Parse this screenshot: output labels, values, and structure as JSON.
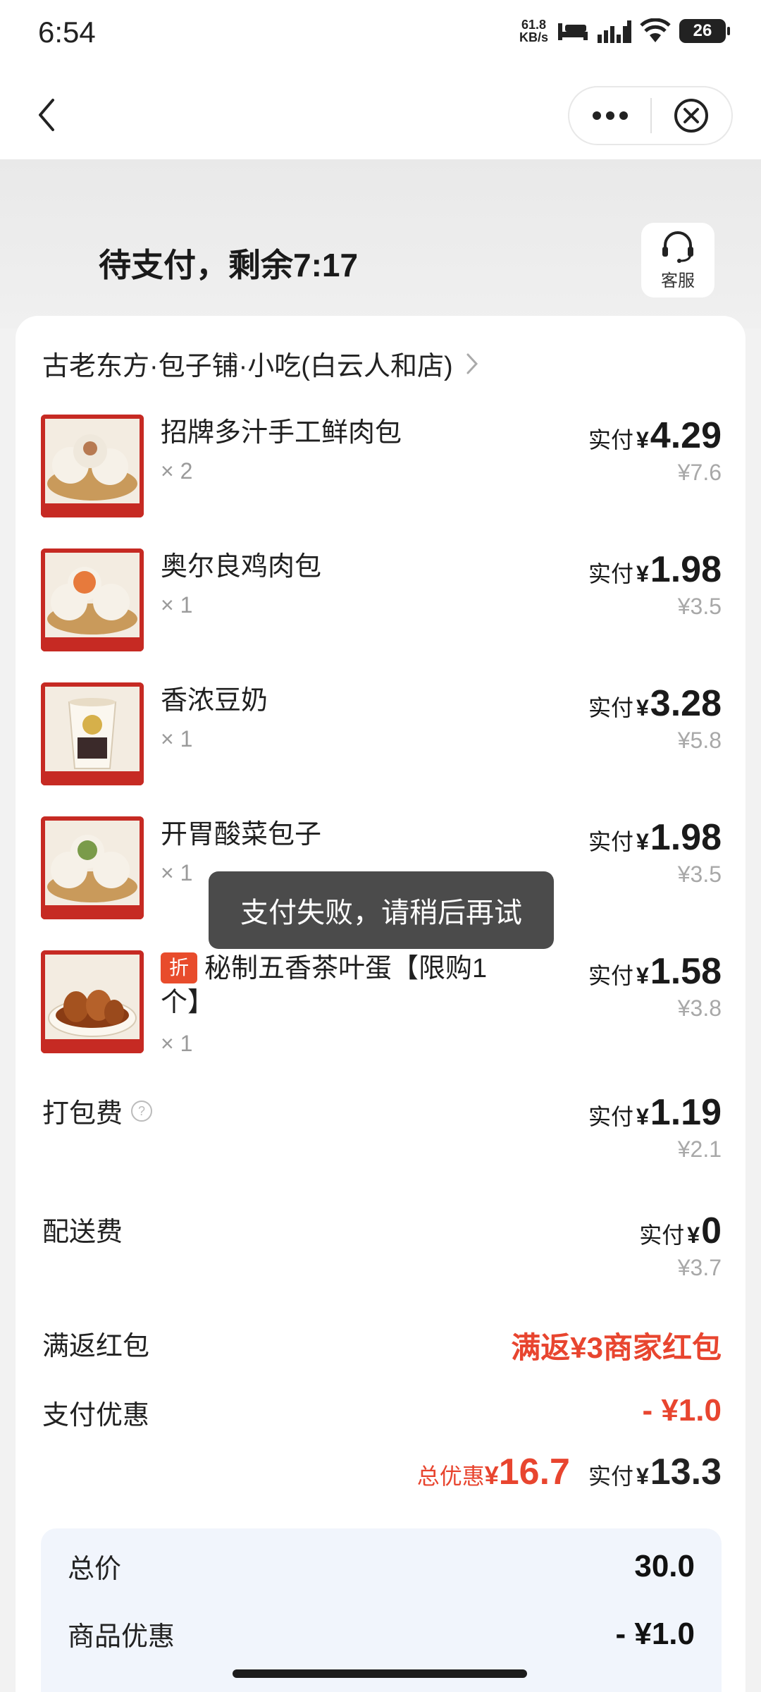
{
  "status_bar": {
    "time": "6:54",
    "net_speed_value": "61.8",
    "net_speed_unit": "KB/s",
    "battery": "26"
  },
  "nav": {
    "back_icon": "chevron-left-icon",
    "more_icon": "more-dots-icon",
    "close_icon": "close-circle-icon"
  },
  "header": {
    "status_text": "待支付，剩余7:17",
    "service_label": "客服"
  },
  "store": {
    "name": "古老东方·包子铺·小吃(白云人和店)"
  },
  "items": [
    {
      "name": "招牌多汁手工鲜肉包",
      "qty": "× 2",
      "paid_label": "实付",
      "yen": "¥",
      "paid": "4.29",
      "original": "¥7.6",
      "tag": ""
    },
    {
      "name": "奥尔良鸡肉包",
      "qty": "× 1",
      "paid_label": "实付",
      "yen": "¥",
      "paid": "1.98",
      "original": "¥3.5",
      "tag": ""
    },
    {
      "name": "香浓豆奶",
      "qty": "× 1",
      "paid_label": "实付",
      "yen": "¥",
      "paid": "3.28",
      "original": "¥5.8",
      "tag": ""
    },
    {
      "name": "开胃酸菜包子",
      "qty": "× 1",
      "paid_label": "实付",
      "yen": "¥",
      "paid": "1.98",
      "original": "¥3.5",
      "tag": ""
    },
    {
      "name": "秘制五香茶叶蛋【限购1个】",
      "qty": "× 1",
      "paid_label": "实付",
      "yen": "¥",
      "paid": "1.58",
      "original": "¥3.8",
      "tag": "折"
    }
  ],
  "fees": {
    "packing": {
      "label": "打包费",
      "paid_label": "实付",
      "yen": "¥",
      "paid": "1.19",
      "original": "¥2.1"
    },
    "delivery": {
      "label": "配送费",
      "paid_label": "实付",
      "yen": "¥",
      "paid": "0",
      "original": "¥3.7"
    },
    "red_packet": {
      "label": "满返红包",
      "value": "满返¥3商家红包"
    },
    "payment_discount": {
      "label": "支付优惠",
      "value": "- ¥1.0"
    }
  },
  "totals": {
    "discount_label": "总优惠",
    "discount_yen": "¥",
    "discount_amount": "16.7",
    "paid_label": "实付",
    "paid_yen": "¥",
    "paid_amount": "13.3"
  },
  "summary": {
    "total_label": "总价",
    "total_value": "30.0",
    "goods_discount_label": "商品优惠",
    "goods_discount_value": "- ¥1.0"
  },
  "toast": {
    "message": "支付失败，请稍后再试"
  },
  "colors": {
    "accent_red": "#e8452f",
    "tag_red": "#e84c2c",
    "summary_bg": "#f1f5fc"
  }
}
